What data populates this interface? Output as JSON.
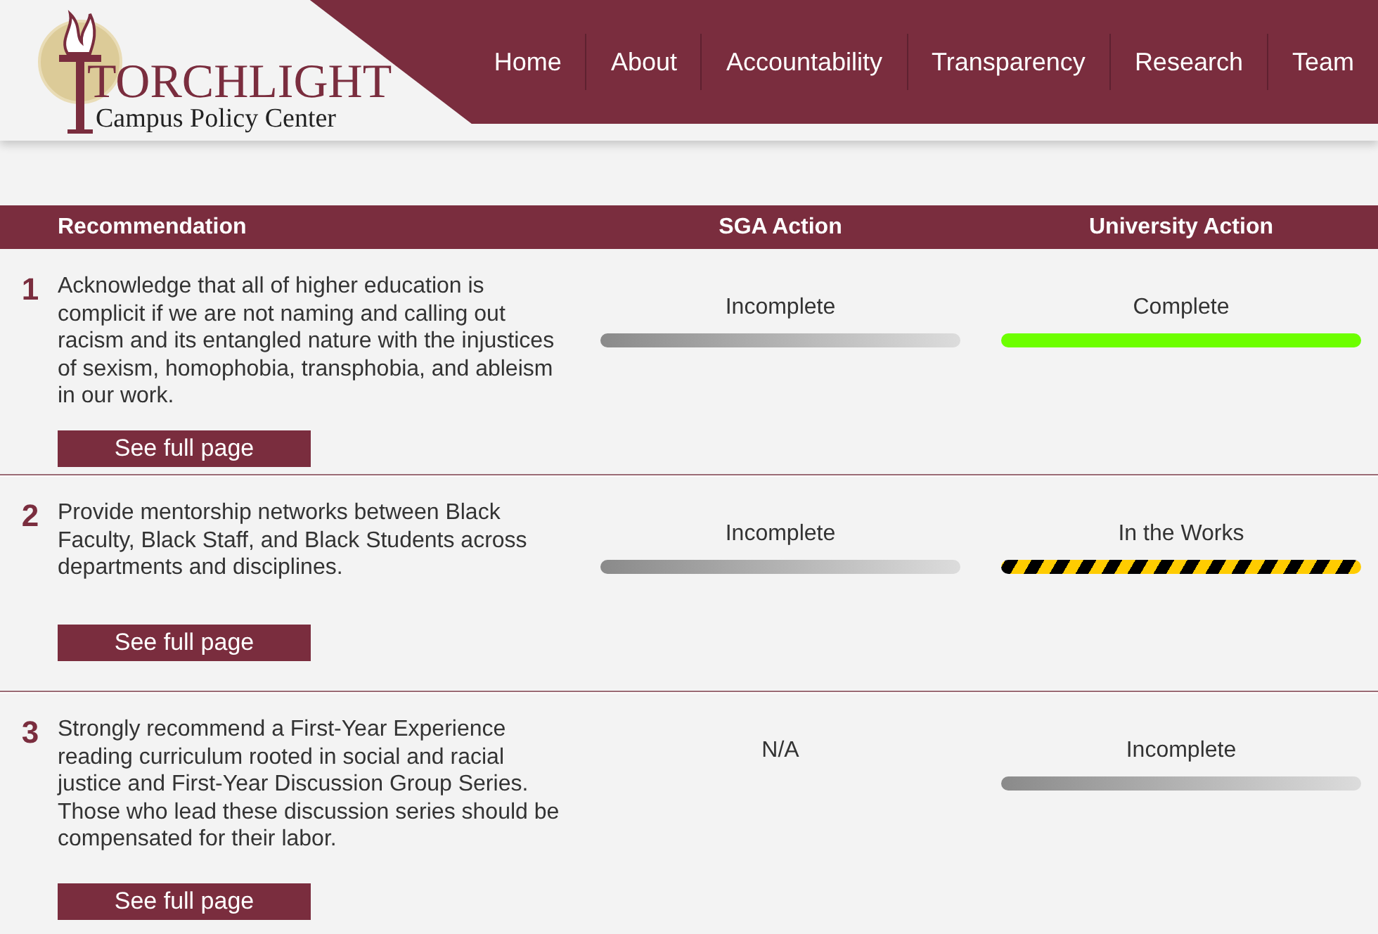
{
  "logo": {
    "title": "TORCHLIGHT",
    "subtitle": "Campus Policy Center"
  },
  "nav": [
    "Home",
    "About",
    "Accountability",
    "Transparency",
    "Research",
    "Team"
  ],
  "table": {
    "columns": [
      "Recommendation",
      "SGA Action",
      "University Action"
    ],
    "rows": [
      {
        "number": "1",
        "text": "Acknowledge that all of higher education is complicit if we are not naming and calling out racism and its entangled nature with the injustices of sexism, homophobia, transphobia, and ableism in our work.",
        "button": "See full page",
        "sga": {
          "label": "Incomplete",
          "kind": "incomplete"
        },
        "university": {
          "label": "Complete",
          "kind": "complete"
        }
      },
      {
        "number": "2",
        "text": "Provide mentorship networks between Black Faculty, Black Staff, and Black Students across departments and disciplines.",
        "button": "See full page",
        "sga": {
          "label": "Incomplete",
          "kind": "incomplete"
        },
        "university": {
          "label": "In the Works",
          "kind": "in_progress"
        }
      },
      {
        "number": "3",
        "text": "Strongly recommend a First-Year Experience reading curriculum rooted in social and racial justice and First-Year Discussion Group Series. Those who lead these discussion series should be compensated for their labor.",
        "button": "See full page",
        "sga": {
          "label": "N/A",
          "kind": "na"
        },
        "university": {
          "label": "Incomplete",
          "kind": "incomplete"
        }
      }
    ]
  }
}
